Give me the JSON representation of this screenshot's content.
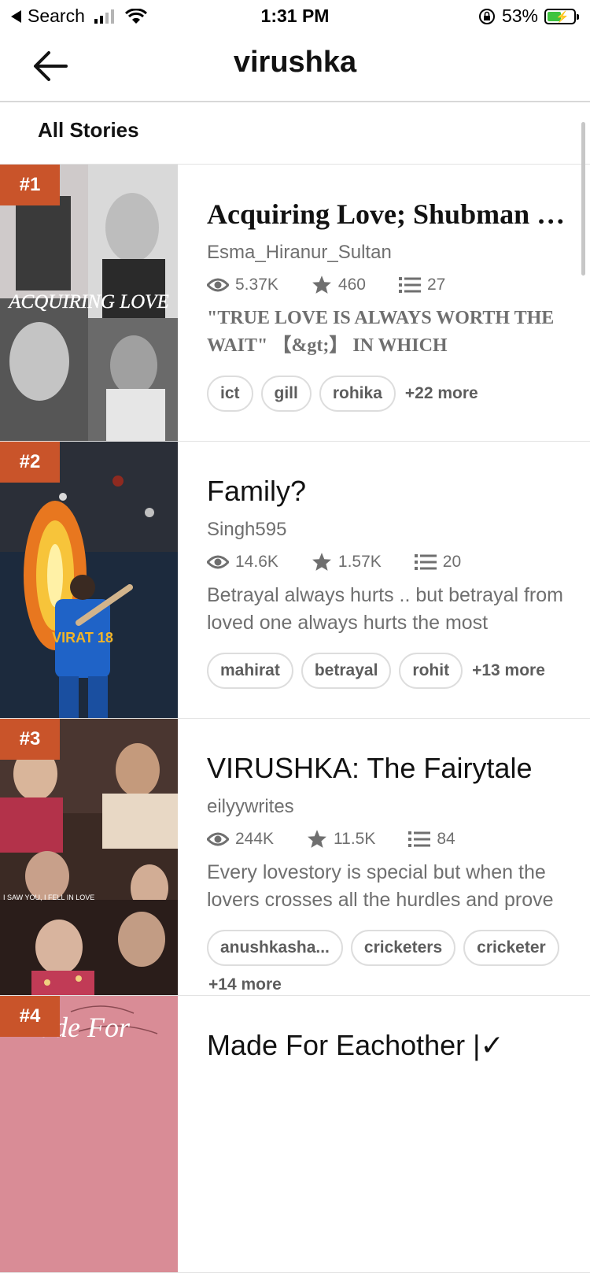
{
  "status_bar": {
    "back_label": "Search",
    "time": "1:31 PM",
    "battery_percent": "53%",
    "battery_level": 0.53
  },
  "header": {
    "title": "virushka"
  },
  "section": {
    "label": "All Stories"
  },
  "stories": [
    {
      "rank": "#1",
      "title": "Acquiring Love; Shubman Gill",
      "author": "Esma_Hiranur_Sultan",
      "reads": "5.37K",
      "votes": "460",
      "parts": "27",
      "description": "\"TRUE LOVE IS ALWAYS WORTH THE WAIT\" 【&gt;】 IN WHICH",
      "tags": [
        "ict",
        "gill",
        "rohika"
      ],
      "more": "+22 more",
      "cover_text": "ACQUIRING LOVE"
    },
    {
      "rank": "#2",
      "title": "Family?",
      "author": "Singh595",
      "reads": "14.6K",
      "votes": "1.57K",
      "parts": "20",
      "description": "Betrayal always hurts .. but betrayal from loved one always hurts the most",
      "tags": [
        "mahirat",
        "betrayal",
        "rohit"
      ],
      "more": "+13 more",
      "cover_text": "VIRAT 18"
    },
    {
      "rank": "#3",
      "title": "VIRUSHKA: The Fairytale",
      "author": "eilyywrites",
      "reads": "244K",
      "votes": "11.5K",
      "parts": "84",
      "description": "Every lovestory is special but when the lovers crosses all the hurdles and prove",
      "tags": [
        "anushkasha...",
        "cricketers",
        "cricketer"
      ],
      "more": "+14 more",
      "cover_text": "I SAW YOU, I FELL IN LOVE"
    },
    {
      "rank": "#4",
      "title": "Made For Eachother |✓",
      "cover_text": "Made For"
    }
  ]
}
